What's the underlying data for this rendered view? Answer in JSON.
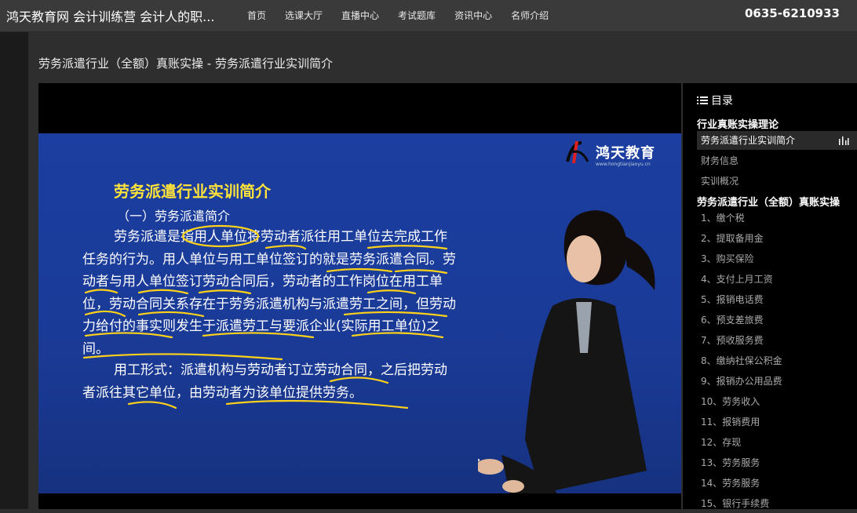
{
  "header": {
    "site_title": "鸿天教育网 会计训练营 会计人的职...",
    "nav": [
      "首页",
      "选课大厅",
      "直播中心",
      "考试题库",
      "资讯中心",
      "名师介绍"
    ],
    "phone": "0635-6210933"
  },
  "page": {
    "heading": "劳务派遣行业（全额）真账实操 - 劳务派遣行业实训简介"
  },
  "slide": {
    "logo_text": "鸿天教育",
    "logo_url": "www.hongtianjiaoyu.cn",
    "title": "劳务派遣行业实训简介",
    "subtitle": "（一）劳务派遣简介",
    "paragraph1": "劳务派遣是指用人单位将劳动者派往用工单位去完成工作任务的行为。用人单位与用工单位签订的就是劳务派遣合同。劳动者与用人单位签订劳动合同后，劳动者的工作岗位在用工单位，劳动合同关系存在于劳务派遣机构与派遣劳工之间，但劳动力给付的事实则发生于派遣劳工与要派企业(实际用工单位)之间。",
    "paragraph2": "用工形式：派遣机构与劳动者订立劳动合同，之后把劳动者派往其它单位，由劳动者为该单位提供劳务。"
  },
  "toc": {
    "header": "目录",
    "sections": [
      {
        "title": "行业真账实操理论",
        "items": [
          "劳务派遣行业实训简介",
          "财务信息",
          "实训概况"
        ]
      },
      {
        "title": "劳务派遣行业（全额）真账实操",
        "items": [
          "1、缴个税",
          "2、提取备用金",
          "3、购买保险",
          "4、支付上月工资",
          "5、报销电话费",
          "6、预支差旅费",
          "7、预收服务费",
          "8、缴纳社保公积金",
          "9、报销办公用品费",
          "10、劳务收入",
          "11、报销费用",
          "12、存现",
          "13、劳务服务",
          "14、劳务服务",
          "15、银行手续费"
        ]
      }
    ]
  },
  "colors": {
    "slide_title": "#ffe23a",
    "slide_bg": "#1b3ea0",
    "scribble": "#ffd21a"
  }
}
